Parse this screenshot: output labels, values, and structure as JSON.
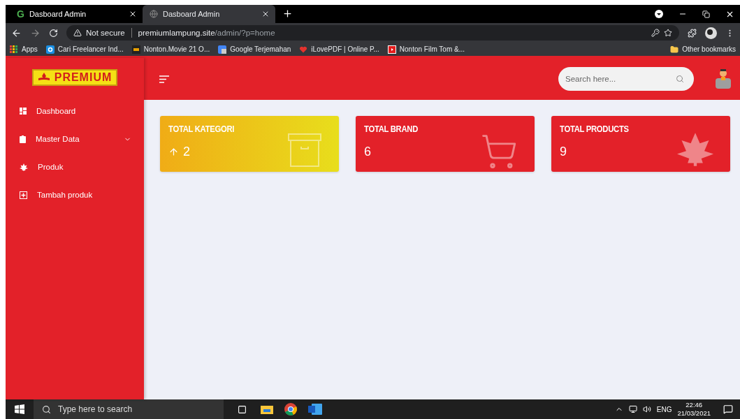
{
  "browser": {
    "tabs": [
      {
        "favicon_text": "G",
        "title": "Dasboard Admin",
        "selected": false
      },
      {
        "title": "Dasboard Admin",
        "selected": true
      }
    ],
    "address": {
      "security": "Not secure",
      "domain": "premiumlampung.site",
      "path": "/admin/?p=home"
    },
    "bookmarks": [
      {
        "label": "Apps"
      },
      {
        "label": "Cari Freelancer Ind..."
      },
      {
        "label": "Nonton.Movie 21 O..."
      },
      {
        "label": "Google Terjemahan"
      },
      {
        "label": "iLovePDF | Online P..."
      },
      {
        "label": "Nonton Film Tom &..."
      }
    ],
    "other_bookmarks": "Other bookmarks"
  },
  "sidebar": {
    "logo": "PREMIUM",
    "items": [
      {
        "label": "Dashboard",
        "kind": "link"
      },
      {
        "label": "Master Data",
        "kind": "dropdown",
        "expanded": false
      },
      {
        "label": "Produk",
        "kind": "link"
      },
      {
        "label": "Tambah produk",
        "kind": "link"
      }
    ]
  },
  "header": {
    "search": {
      "placeholder": "Search here..."
    }
  },
  "cards": [
    {
      "title": "TOTAL KATEGORI",
      "value": "2",
      "kind": "trend",
      "color": "#f0ac16"
    },
    {
      "title": "TOTAL BRAND",
      "value": "6",
      "kind": "plain",
      "color": "#e32129"
    },
    {
      "title": "TOTAL PRODUCTS",
      "value": "9",
      "kind": "plain",
      "color": "#e32129"
    }
  ],
  "taskbar": {
    "search": {
      "placeholder": "Type here to search"
    },
    "language": "ENG",
    "time": "22:46",
    "date": "21/03/2021"
  }
}
